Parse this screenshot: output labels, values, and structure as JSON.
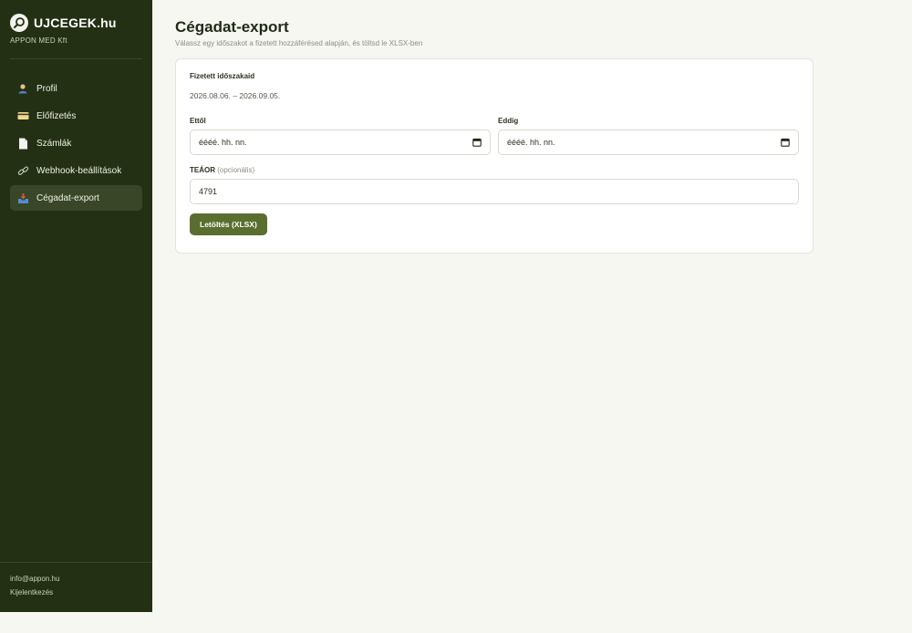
{
  "brand": {
    "name": "UJCEGEK.hu",
    "company": "APPON MED Kft"
  },
  "sidebar": {
    "items": [
      {
        "label": "Profil",
        "icon": "user-icon"
      },
      {
        "label": "Előfizetés",
        "icon": "credit-card-icon"
      },
      {
        "label": "Számlák",
        "icon": "document-icon"
      },
      {
        "label": "Webhook-beállítások",
        "icon": "link-icon"
      },
      {
        "label": "Cégadat-export",
        "icon": "inbox-tray-icon",
        "active": true
      }
    ],
    "footer": {
      "email": "info@appon.hu",
      "logout": "Kijelentkezés"
    }
  },
  "page": {
    "title": "Cégadat-export",
    "subtitle": "Válassz egy időszakot a fizetett hozzáférésed alapján, és töltsd le XLSX-ben"
  },
  "form": {
    "paid_periods_label": "Fizetett időszakaid",
    "paid_period": "2026.08.06. – 2026.09.05.",
    "from_label": "Ettől",
    "from_value": "éééé. hh. nn.",
    "to_label": "Eddig",
    "to_value": "éééé. hh. nn.",
    "teaor_label": "TEÁOR",
    "teaor_optional": "(opcionális)",
    "teaor_value": "4791",
    "download_button": "Letöltés (XLSX)"
  },
  "colors": {
    "sidebar_bg": "#243014",
    "accent": "#5a6e2f",
    "page_bg": "#f7f7f2"
  }
}
